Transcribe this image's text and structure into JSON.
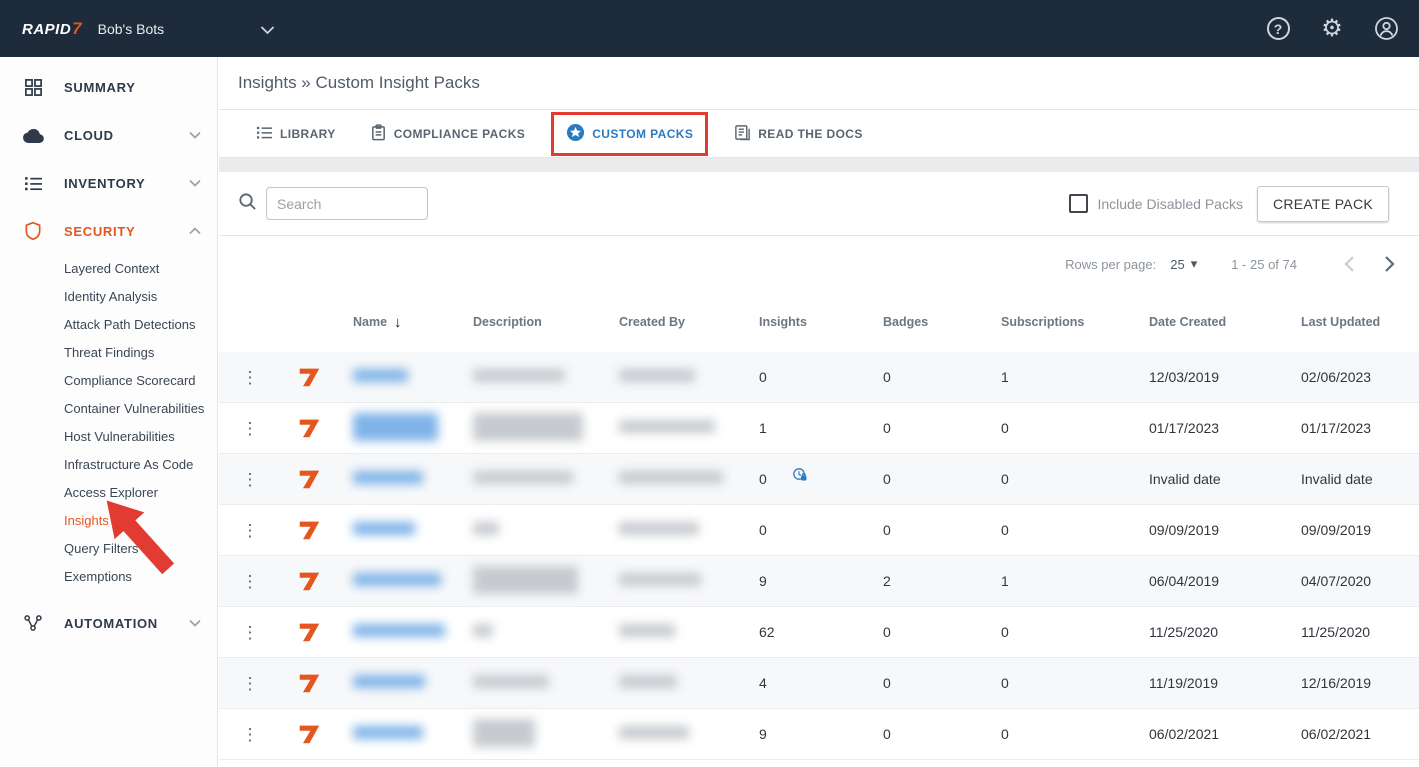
{
  "colors": {
    "topbar_bg": "#1d2b3a",
    "accent_orange": "#e4561f",
    "active_blue": "#2b7ac2",
    "annotation_red": "#e23c32"
  },
  "topbar": {
    "logo_text": "RAPID",
    "logo_seven": "7",
    "org_name": "Bob's Bots"
  },
  "icons": {
    "help": "?",
    "gear": "⚙",
    "kebab": "⋮",
    "sort_desc": "↓",
    "dropdown_caret": "▾"
  },
  "sidebar": {
    "items": [
      {
        "label": "SUMMARY"
      },
      {
        "label": "CLOUD"
      },
      {
        "label": "INVENTORY"
      },
      {
        "label": "SECURITY"
      },
      {
        "label": "AUTOMATION"
      }
    ],
    "security_subitems": [
      "Layered Context",
      "Identity Analysis",
      "Attack Path Detections",
      "Threat Findings",
      "Compliance Scorecard",
      "Container Vulnerabilities",
      "Host Vulnerabilities",
      "Infrastructure As Code",
      "Access Explorer",
      "Insights",
      "Query Filters",
      "Exemptions"
    ]
  },
  "header": {
    "breadcrumb": "Insights » Custom Insight Packs"
  },
  "tabs": [
    {
      "label": "LIBRARY",
      "active": false
    },
    {
      "label": "COMPLIANCE PACKS",
      "active": false
    },
    {
      "label": "CUSTOM PACKS",
      "active": true,
      "annotated": true
    },
    {
      "label": "READ THE DOCS",
      "active": false
    }
  ],
  "toolbar": {
    "search_placeholder": "Search",
    "include_disabled_label": "Include Disabled Packs",
    "include_disabled_checked": false,
    "create_pack_label": "CREATE PACK"
  },
  "pagination": {
    "rows_per_page_label": "Rows per page:",
    "rows_per_page_value": "25",
    "range_label": "1 - 25 of 74"
  },
  "table": {
    "columns": [
      "Name",
      "Description",
      "Created By",
      "Insights",
      "Badges",
      "Subscriptions",
      "Date Created",
      "Last Updated"
    ],
    "sort_column": "Name",
    "sort_direction": "desc",
    "rows": [
      {
        "insights": "0",
        "badges": "0",
        "subscriptions": "1",
        "date_created": "12/03/2019",
        "last_updated": "02/06/2023",
        "has_lock": false
      },
      {
        "insights": "1",
        "badges": "0",
        "subscriptions": "0",
        "date_created": "01/17/2023",
        "last_updated": "01/17/2023",
        "has_lock": false
      },
      {
        "insights": "0",
        "badges": "0",
        "subscriptions": "0",
        "date_created": "Invalid date",
        "last_updated": "Invalid date",
        "has_lock": true
      },
      {
        "insights": "0",
        "badges": "0",
        "subscriptions": "0",
        "date_created": "09/09/2019",
        "last_updated": "09/09/2019",
        "has_lock": false
      },
      {
        "insights": "9",
        "badges": "2",
        "subscriptions": "1",
        "date_created": "06/04/2019",
        "last_updated": "04/07/2020",
        "has_lock": false
      },
      {
        "insights": "62",
        "badges": "0",
        "subscriptions": "0",
        "date_created": "11/25/2020",
        "last_updated": "11/25/2020",
        "has_lock": false
      },
      {
        "insights": "4",
        "badges": "0",
        "subscriptions": "0",
        "date_created": "11/19/2019",
        "last_updated": "12/16/2019",
        "has_lock": false
      },
      {
        "insights": "9",
        "badges": "0",
        "subscriptions": "0",
        "date_created": "06/02/2021",
        "last_updated": "06/02/2021",
        "has_lock": false
      }
    ]
  }
}
